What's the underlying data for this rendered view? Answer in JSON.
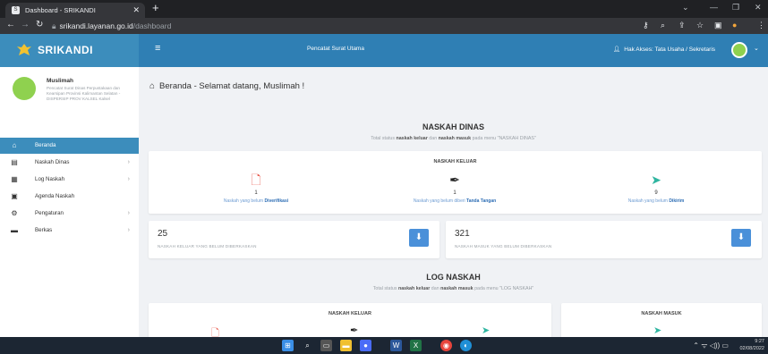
{
  "browser": {
    "tab_title": "Dashboard - SRIKANDI",
    "url_host": "srikandi.layanan.go.id",
    "url_path": "/dashboard"
  },
  "app": {
    "brand": "SRIKANDI",
    "role_title": "Pencatat Surat Utama",
    "access_label": "Hak Akses: Tata Usaha / Sekretaris",
    "accent_color": "#3c8dbc"
  },
  "user": {
    "name": "Muslimah",
    "description": "Pencatat Surat Dinas Perpustakaan dan Kearsipan Provinsi Kalimantan Selatan - DISPERSIP PROV KALSEL Kalsel"
  },
  "menu": [
    {
      "label": "Beranda",
      "icon": "home-icon",
      "active": true,
      "arrow": false
    },
    {
      "label": "Naskah Dinas",
      "icon": "document-icon",
      "active": false,
      "arrow": true
    },
    {
      "label": "Log Naskah",
      "icon": "log-icon",
      "active": false,
      "arrow": true
    },
    {
      "label": "Agenda Naskah",
      "icon": "agenda-icon",
      "active": false,
      "arrow": false
    },
    {
      "label": "Pengaturan",
      "icon": "gear-icon",
      "active": false,
      "arrow": true
    },
    {
      "label": "Berkas",
      "icon": "folder-icon",
      "active": false,
      "arrow": true
    }
  ],
  "content": {
    "greeting_page": "Beranda",
    "greeting_text": " - Selamat datang, Muslimah !",
    "naskah_dinas": {
      "title": "NASKAH DINAS",
      "sub_pre": "Total status ",
      "sub_b1": "naskah keluar",
      "sub_mid": " dan ",
      "sub_b2": "naskah masuk",
      "sub_post": " pada menu \"NASKAH DINAS\"",
      "card_title": "NASKAH KELUAR",
      "stats": [
        {
          "value": "1",
          "caption": "Naskah yang belum ",
          "caption_bold": "Diverifikasi",
          "icon": "document-icon",
          "color": "#e8574a"
        },
        {
          "value": "1",
          "caption": "Naskah yang belum diberi ",
          "caption_bold": "Tanda Tangan",
          "icon": "pen-icon",
          "color": "#222222"
        },
        {
          "value": "9",
          "caption": "Naskah yang belum ",
          "caption_bold": "Dikirim",
          "icon": "send-icon",
          "color": "#2fb5a0"
        }
      ]
    },
    "counts": [
      {
        "value": "25",
        "caption": "NASKAH KELUAR YANG BELUM DIBERKASKAN"
      },
      {
        "value": "321",
        "caption": "NASKAH MASUK YANG BELUM DIBERKASKAN"
      }
    ],
    "log_naskah": {
      "title": "LOG NASKAH",
      "sub_pre": "Total status ",
      "sub_b1": "naskah keluar",
      "sub_mid": " dan ",
      "sub_b2": "naskah masuk",
      "sub_post": " pada menu \"LOG NASKAH\"",
      "card_left_title": "NASKAH KELUAR",
      "card_right_title": "NASKAH MASUK"
    }
  },
  "taskbar": {
    "time": "9:27",
    "date": "02/08/2022"
  }
}
